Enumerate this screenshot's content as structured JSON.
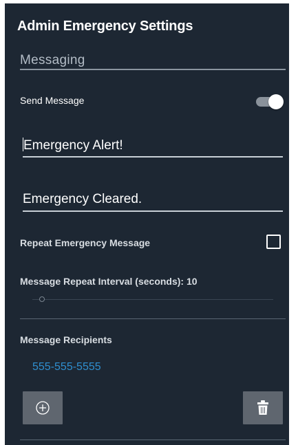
{
  "header": {
    "title": "Admin Emergency Settings"
  },
  "messaging": {
    "section_title": "Messaging",
    "send_message_label": "Send Message",
    "send_message_enabled": true,
    "emergency_message_value": "Emergency Alert!",
    "cleared_message_value": "Emergency Cleared.",
    "repeat_label": "Repeat Emergency Message",
    "repeat_checked": false,
    "interval_label": "Message Repeat Interval (seconds): 10",
    "interval_value": 10
  },
  "recipients": {
    "section_label": "Message Recipients",
    "items": [
      "555-555-5555"
    ]
  },
  "actions": {
    "add_icon": "plus-circle-icon",
    "delete_icon": "trash-icon"
  },
  "colors": {
    "background": "#1d2733",
    "accent_link": "#2f8fd0",
    "button_bg": "#5f666f"
  }
}
